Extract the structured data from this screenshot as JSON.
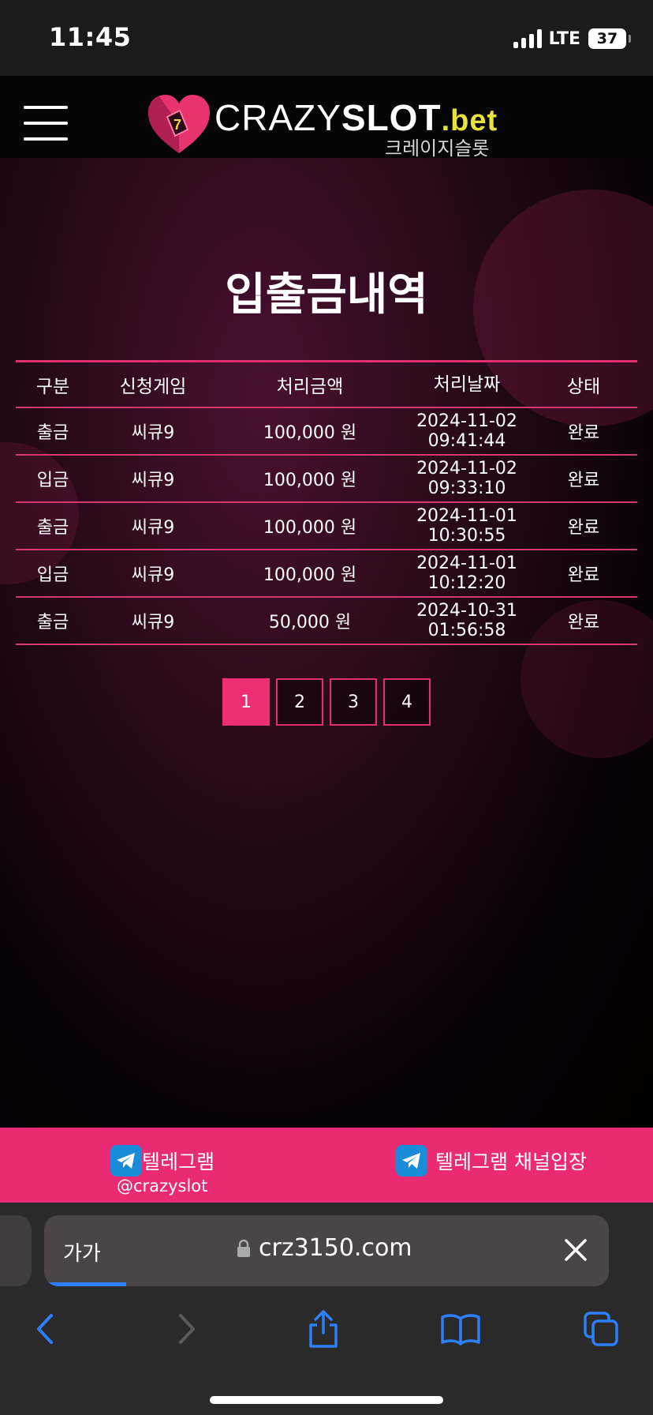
{
  "status_bar": {
    "time": "11:45",
    "network": "LTE",
    "battery": "37"
  },
  "header": {
    "menu_icon": "hamburger-menu-icon",
    "logo": {
      "part1": "CRAZY",
      "part2": "SLOT",
      "part3": ".bet",
      "subtitle": "크레이지슬롯"
    }
  },
  "page": {
    "title": "입출금내역"
  },
  "table": {
    "headers": [
      "구분",
      "신청게임",
      "처리금액",
      "처리날짜",
      "상태"
    ],
    "rows": [
      {
        "type": "출금",
        "game": "씨큐9",
        "amount": "100,000 원",
        "date": "2024-11-02",
        "time": "09:41:44",
        "status": "완료"
      },
      {
        "type": "입금",
        "game": "씨큐9",
        "amount": "100,000 원",
        "date": "2024-11-02",
        "time": "09:33:10",
        "status": "완료"
      },
      {
        "type": "출금",
        "game": "씨큐9",
        "amount": "100,000 원",
        "date": "2024-11-01",
        "time": "10:30:55",
        "status": "완료"
      },
      {
        "type": "입금",
        "game": "씨큐9",
        "amount": "100,000 원",
        "date": "2024-11-01",
        "time": "10:12:20",
        "status": "완료"
      },
      {
        "type": "출금",
        "game": "씨큐9",
        "amount": "50,000 원",
        "date": "2024-10-31",
        "time": "01:56:58",
        "status": "완료"
      }
    ]
  },
  "pagination": {
    "pages": [
      "1",
      "2",
      "3",
      "4"
    ],
    "current": "1"
  },
  "telegram_bar": {
    "left_label": "텔레그램",
    "left_handle": "@crazyslot",
    "right_label": "텔레그램 채널입장"
  },
  "browser": {
    "aa_label": "가가",
    "url": "crz3150.com"
  },
  "colors": {
    "accent": "#ea2a72",
    "table_line": "#d3396d",
    "logo_bet": "#e8e23a",
    "telegram_blue": "#1a8bd6"
  }
}
